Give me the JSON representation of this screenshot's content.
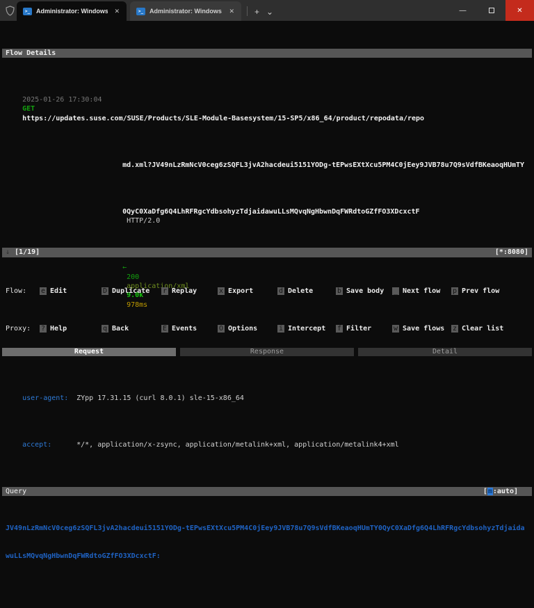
{
  "window": {
    "tabs": [
      {
        "title": "Administrator: Windows Pow",
        "close_glyph": "✕"
      },
      {
        "title": "Administrator: Windows Powe",
        "close_glyph": "✕"
      }
    ],
    "ps_icon_glyph": ">_",
    "new_tab_button": "+",
    "tab_dropdown_button": "⌄",
    "controls": {
      "minimize": "—",
      "close": "✕"
    }
  },
  "flow_details": {
    "title": "Flow Details",
    "request_line": {
      "timestamp": "2025-01-26 17:30:04",
      "method": "GET",
      "url_line1": "https://updates.suse.com/SUSE/Products/SLE-Module-Basesystem/15-SP5/x86_64/product/repodata/repo",
      "url_line2": "md.xml?JV49nLzRmNcV0ceg6zSQFL3jvA2hacdeui5151YODg-tEPwsEXtXcu5PM4C0jEey9JVB78u7Q9sVdfBKeaoqHUmTY",
      "url_line3": "0QyC0XaDfg6Q4LhRFRgcYdbsohyzTdjaidawuLLsMQvqNgHbwnDqFWRdtoGZfFO3XDcxctF",
      "http_version": "HTTP/2.0"
    },
    "response_summary": {
      "arrow": "←",
      "status_code": "200",
      "content_type": "application/xml",
      "size": "9.0k",
      "duration": "978ms"
    },
    "tabs": [
      {
        "label": "Request"
      },
      {
        "label": "Response"
      },
      {
        "label": "Detail"
      }
    ],
    "headers": [
      {
        "key": "user-agent:",
        "value": "ZYpp 17.31.15 (curl 8.0.1) sle-15-x86_64"
      },
      {
        "key": "accept:",
        "value": "*/*, application/x-zsync, application/metalink+xml, application/metalink4+xml"
      }
    ],
    "query": {
      "title": "Query",
      "mode_open": "[",
      "mode_key": "m",
      "mode_rest": ":auto]",
      "value_line1": "JV49nLzRmNcV0ceg6zSQFL3jvA2hacdeui5151YODg-tEPwsEXtXcu5PM4C0jEey9JVB78u7Q9sVdfBKeaoqHUmTY0QyC0XaDfg6Q4LhRFRgcYdbsohyzTdjaida",
      "value_line2": "wuLLsMQvqNgHbwnDqFWRdtoGZfFO3XDcxctF:"
    }
  },
  "status_bar": {
    "arrow": "↓",
    "position": "[1/19]",
    "bind_address": "[*:8080]"
  },
  "command_bar": {
    "rows": [
      {
        "label": "Flow:",
        "items": [
          {
            "key": "e",
            "label": "Edit"
          },
          {
            "key": "D",
            "label": "Duplicate"
          },
          {
            "key": "r",
            "label": "Replay"
          },
          {
            "key": "x",
            "label": "Export"
          },
          {
            "key": "d",
            "label": "Delete"
          },
          {
            "key": "b",
            "label": "Save body"
          },
          {
            "key": "_",
            "label": "Next flow"
          },
          {
            "key": "p",
            "label": "Prev flow"
          }
        ]
      },
      {
        "label": "Proxy:",
        "items": [
          {
            "key": "?",
            "label": "Help"
          },
          {
            "key": "q",
            "label": "Back"
          },
          {
            "key": "E",
            "label": "Events"
          },
          {
            "key": "O",
            "label": "Options"
          },
          {
            "key": "i",
            "label": "Intercept"
          },
          {
            "key": "f",
            "label": "Filter"
          },
          {
            "key": "w",
            "label": "Save flows"
          },
          {
            "key": "z",
            "label": "Clear list"
          }
        ]
      }
    ]
  },
  "colors": {
    "terminal_bg": "#0c0c0c",
    "bar_gray": "#565656",
    "green": "#13a10e",
    "bright_green": "#16c60c",
    "dark_yellow": "#c19c00",
    "header_blue": "#2e7bd8",
    "query_blue": "#1f63c4",
    "close_red": "#c42b1c"
  }
}
